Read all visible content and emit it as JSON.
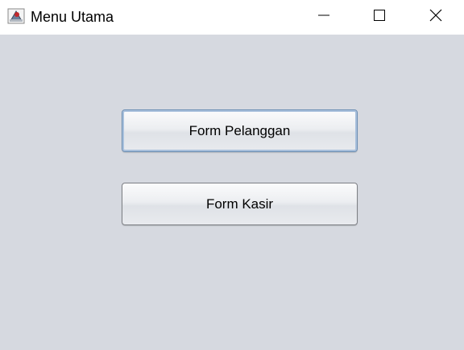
{
  "window": {
    "title": "Menu Utama",
    "app_icon": "java-app-icon",
    "controls": {
      "minimize_icon": "minimize-icon",
      "maximize_icon": "maximize-icon",
      "close_icon": "close-icon"
    }
  },
  "main": {
    "buttons": [
      {
        "label": "Form Pelanggan",
        "focused": true
      },
      {
        "label": "Form Kasir",
        "focused": false
      }
    ]
  },
  "colors": {
    "background": "#d6d9e0",
    "titlebar": "#ffffff",
    "focus_border": "#6d8fb4"
  }
}
